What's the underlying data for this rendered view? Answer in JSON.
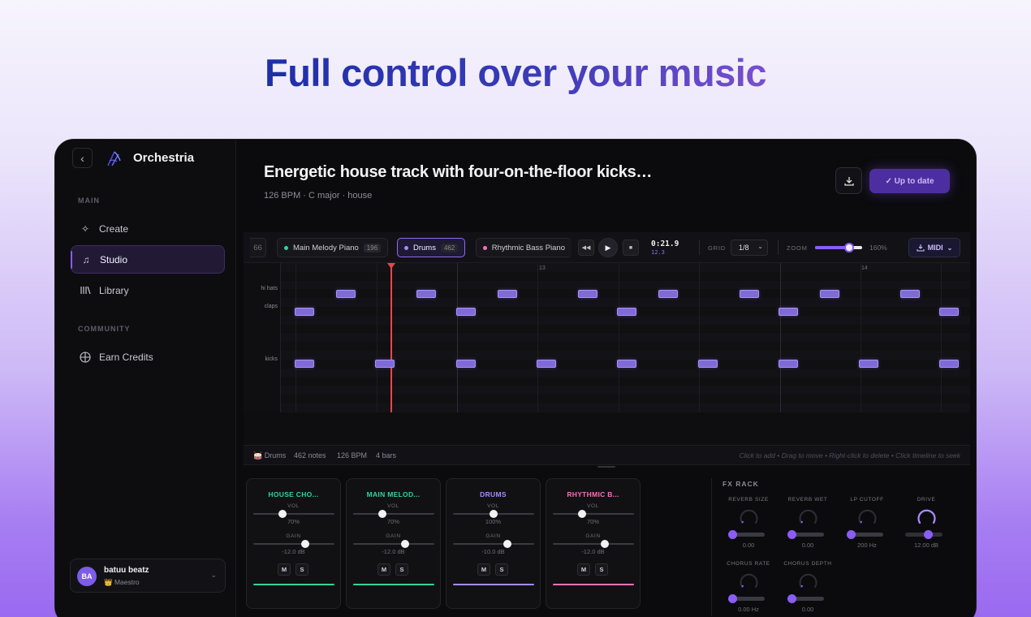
{
  "hero": {
    "title": "Full control over your music"
  },
  "sidebar": {
    "brand": "Orchestria",
    "sections": [
      {
        "label": "MAIN",
        "items": [
          {
            "label": "Create",
            "icon": "sparkle-icon"
          },
          {
            "label": "Studio",
            "icon": "music-note-icon",
            "active": true
          },
          {
            "label": "Library",
            "icon": "library-icon"
          }
        ]
      },
      {
        "label": "COMMUNITY",
        "items": [
          {
            "label": "Earn Credits",
            "icon": "globe-icon"
          }
        ]
      }
    ],
    "user": {
      "initials": "BA",
      "name": "batuu beatz",
      "plan": "👑 Maestro"
    }
  },
  "header": {
    "title": "Energetic house track with four-on-the-floor kicks…",
    "meta": "126 BPM · C major · house",
    "status_button": "✓ Up to date"
  },
  "toolbar": {
    "tabs": [
      {
        "label": "66",
        "partial": true
      },
      {
        "label": "Main Melody Piano",
        "count": "196",
        "color": "#34d399"
      },
      {
        "label": "Drums",
        "count": "462",
        "color": "#a78bfa",
        "active": true
      },
      {
        "label": "Rhythmic Bass Piano",
        "color": "#f472b6"
      }
    ],
    "time": "0:21.9",
    "time_sub": "12.3",
    "grid_label": "GRID",
    "grid_value": "1/8",
    "zoom_label": "ZOOM",
    "zoom_value": "160%",
    "zoom_level": 0.72,
    "midi_label": "MIDI"
  },
  "roll": {
    "bar_numbers": [
      "13",
      "14"
    ],
    "rows": [
      {
        "name": "hi hats",
        "row": 3
      },
      {
        "name": "claps",
        "row": 5
      },
      {
        "name": "kicks",
        "row": 11
      }
    ]
  },
  "status": {
    "track": "🥁 Drums",
    "notes": "462 notes",
    "bpm": "126 BPM",
    "bars": "4 bars",
    "hint": "Click to add • Drag to move • Right-click to delete • Click timeline to seek"
  },
  "mixer": {
    "vol_label": "VOL",
    "gain_label": "GAIN",
    "mute_label": "M",
    "solo_label": "S",
    "channels": [
      {
        "name": "HOUSE CHO...",
        "color": "#34d399",
        "vol": "70%",
        "vol_level": 0.36,
        "gain": "-12.0 dB",
        "gain_level": 0.64
      },
      {
        "name": "MAIN MELOD...",
        "color": "#34d399",
        "vol": "70%",
        "vol_level": 0.36,
        "gain": "-12.0 dB",
        "gain_level": 0.64
      },
      {
        "name": "DRUMS",
        "color": "#a78bfa",
        "vol": "100%",
        "vol_level": 0.5,
        "gain": "-10.0 dB",
        "gain_level": 0.67
      },
      {
        "name": "RHYTHMIC B...",
        "color": "#f472b6",
        "vol": "70%",
        "vol_level": 0.36,
        "gain": "-12.0 dB",
        "gain_level": 0.64
      }
    ]
  },
  "fx": {
    "title": "FX RACK",
    "units": [
      {
        "label": "REVERB SIZE",
        "value": "0.00",
        "level": 0.0
      },
      {
        "label": "REVERB WET",
        "value": "0.00",
        "level": 0.0
      },
      {
        "label": "LP CUTOFF",
        "value": "200 Hz",
        "level": 0.0
      },
      {
        "label": "DRIVE",
        "value": "12.00 dB",
        "level": 0.6
      },
      {
        "label": "CHORUS RATE",
        "value": "0.00 Hz",
        "level": 0.0
      },
      {
        "label": "CHORUS DEPTH",
        "value": "0.00",
        "level": 0.0
      }
    ]
  }
}
